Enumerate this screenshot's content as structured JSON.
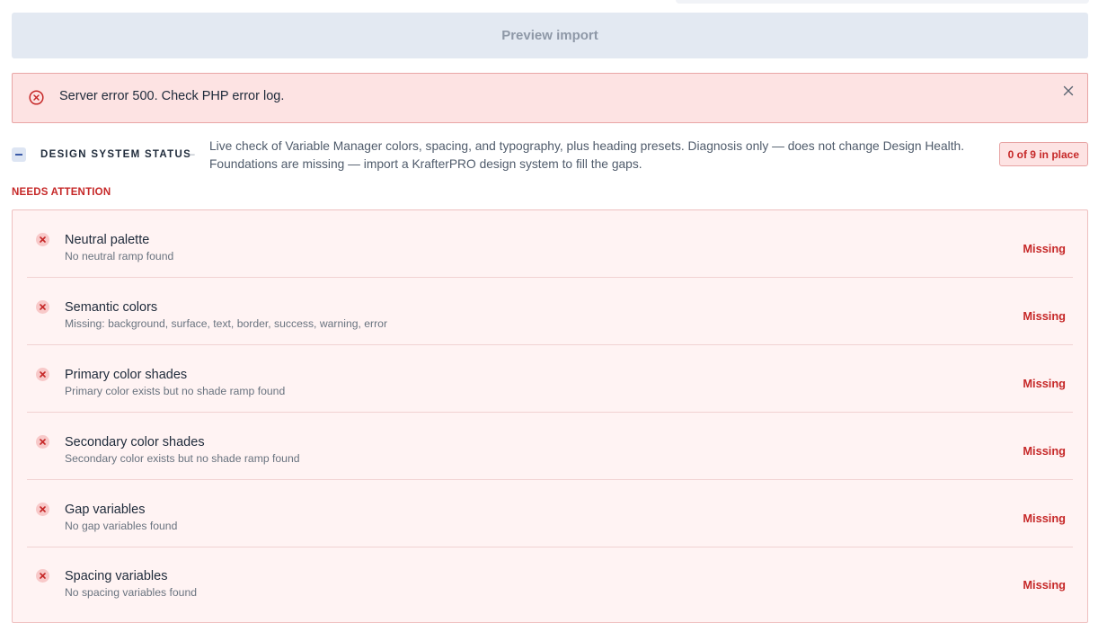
{
  "preview_button": {
    "label": "Preview import"
  },
  "error": {
    "message": "Server error 500. Check PHP error log.",
    "icon": "x-circle-icon"
  },
  "design_system_status": {
    "title": "DESIGN SYSTEM STATUS",
    "separator": "–",
    "description": "Live check of Variable Manager colors, spacing, and typography, plus heading presets. Diagnosis only — does not change Design Health. Foundations are missing — import a KrafterPRO design system to fill the gaps.",
    "badge": "0 of 9 in place"
  },
  "needs_attention": {
    "label": "NEEDS ATTENTION",
    "items": [
      {
        "title": "Neutral palette",
        "description": "No neutral ramp found",
        "status": "Missing"
      },
      {
        "title": "Semantic colors",
        "description": "Missing: background, surface, text, border, success, warning, error",
        "status": "Missing"
      },
      {
        "title": "Primary color shades",
        "description": "Primary color exists but no shade ramp found",
        "status": "Missing"
      },
      {
        "title": "Secondary color shades",
        "description": "Secondary color exists but no shade ramp found",
        "status": "Missing"
      },
      {
        "title": "Gap variables",
        "description": "No gap variables found",
        "status": "Missing"
      },
      {
        "title": "Spacing variables",
        "description": "No spacing variables found",
        "status": "Missing"
      }
    ]
  },
  "colors": {
    "error": "#c62828",
    "error_bg": "#fde3e3",
    "button_bg": "#e3e9f2"
  }
}
